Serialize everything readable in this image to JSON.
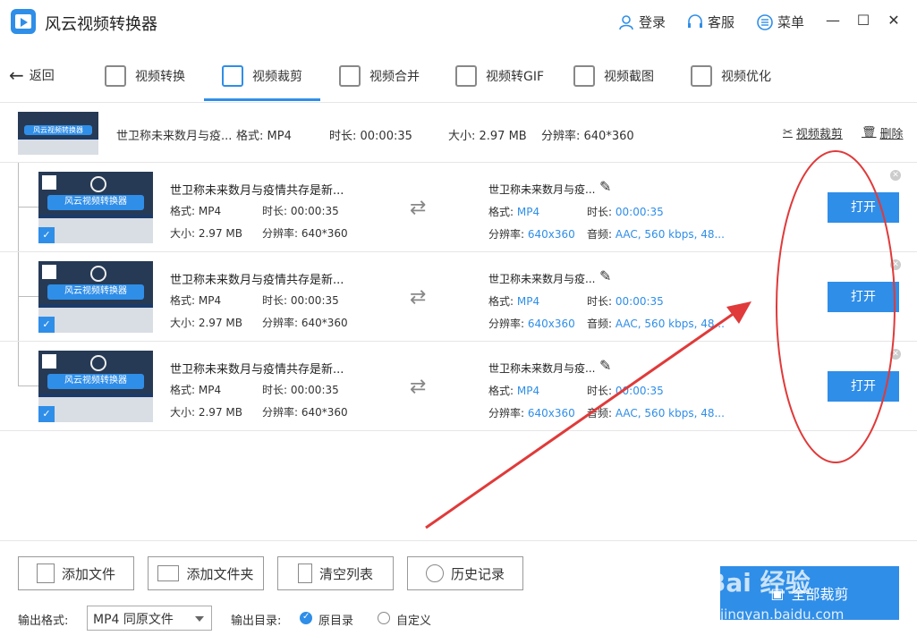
{
  "app": {
    "title": "风云视频转换器",
    "login": "登录",
    "service": "客服",
    "menu": "菜单"
  },
  "nav": {
    "back": "返回",
    "tabs": [
      {
        "label": "视频转换",
        "icon": "video-convert-icon"
      },
      {
        "label": "视频裁剪",
        "icon": "video-crop-icon",
        "active": true
      },
      {
        "label": "视频合并",
        "icon": "video-merge-icon"
      },
      {
        "label": "视频转GIF",
        "icon": "gif-icon"
      },
      {
        "label": "视频截图",
        "icon": "screenshot-icon"
      },
      {
        "label": "视频优化",
        "icon": "optimize-icon"
      }
    ]
  },
  "source": {
    "name": "世卫称未来数月与疫...",
    "format": "格式: MP4",
    "duration": "时长: 00:00:35",
    "size": "大小: 2.97 MB",
    "resolution": "分辨率: 640*360",
    "crop_action": "视频裁剪",
    "delete_action": "删除",
    "thumb_banner": "风云视频转换器"
  },
  "outputs": [
    {
      "src_name": "世卫称未来数月与疫情共存是新...",
      "src_format": "格式: MP4",
      "src_duration": "时长: 00:00:35",
      "src_size": "大小: 2.97 MB",
      "src_resolution": "分辨率: 640*360",
      "out_name": "世卫称未来数月与疫...",
      "out_format_label": "格式:",
      "out_format": "MP4",
      "out_duration_label": "时长:",
      "out_duration": "00:00:35",
      "out_res_label": "分辨率:",
      "out_res": "640x360",
      "out_audio_label": "音频:",
      "out_audio": "AAC, 560 kbps, 48...",
      "open": "打开",
      "thumb_banner": "风云视频转换器"
    },
    {
      "src_name": "世卫称未来数月与疫情共存是新...",
      "src_format": "格式: MP4",
      "src_duration": "时长: 00:00:35",
      "src_size": "大小: 2.97 MB",
      "src_resolution": "分辨率: 640*360",
      "out_name": "世卫称未来数月与疫...",
      "out_format_label": "格式:",
      "out_format": "MP4",
      "out_duration_label": "时长:",
      "out_duration": "00:00:35",
      "out_res_label": "分辨率:",
      "out_res": "640x360",
      "out_audio_label": "音频:",
      "out_audio": "AAC, 560 kbps, 48...",
      "open": "打开",
      "thumb_banner": "风云视频转换器"
    },
    {
      "src_name": "世卫称未来数月与疫情共存是新...",
      "src_format": "格式: MP4",
      "src_duration": "时长: 00:00:35",
      "src_size": "大小: 2.97 MB",
      "src_resolution": "分辨率: 640*360",
      "out_name": "世卫称未来数月与疫...",
      "out_format_label": "格式:",
      "out_format": "MP4",
      "out_duration_label": "时长:",
      "out_duration": "00:00:35",
      "out_res_label": "分辨率:",
      "out_res": "640x360",
      "out_audio_label": "音频:",
      "out_audio": "AAC, 560 kbps, 48...",
      "open": "打开",
      "thumb_banner": "风云视频转换器"
    }
  ],
  "bottom": {
    "add_file": "添加文件",
    "add_folder": "添加文件夹",
    "clear_list": "清空列表",
    "history": "历史记录",
    "output_format_label": "输出格式:",
    "output_format_value": "MP4 同原文件",
    "output_dir_label": "输出目录:",
    "dir_original": "原目录",
    "dir_custom": "自定义",
    "crop_all": "全部裁剪"
  },
  "watermark": {
    "logo": "Bai 经验",
    "url": "jingyan.baidu.com"
  },
  "colors": {
    "accent": "#2f8ee8",
    "annotation": "#e03a3a"
  }
}
